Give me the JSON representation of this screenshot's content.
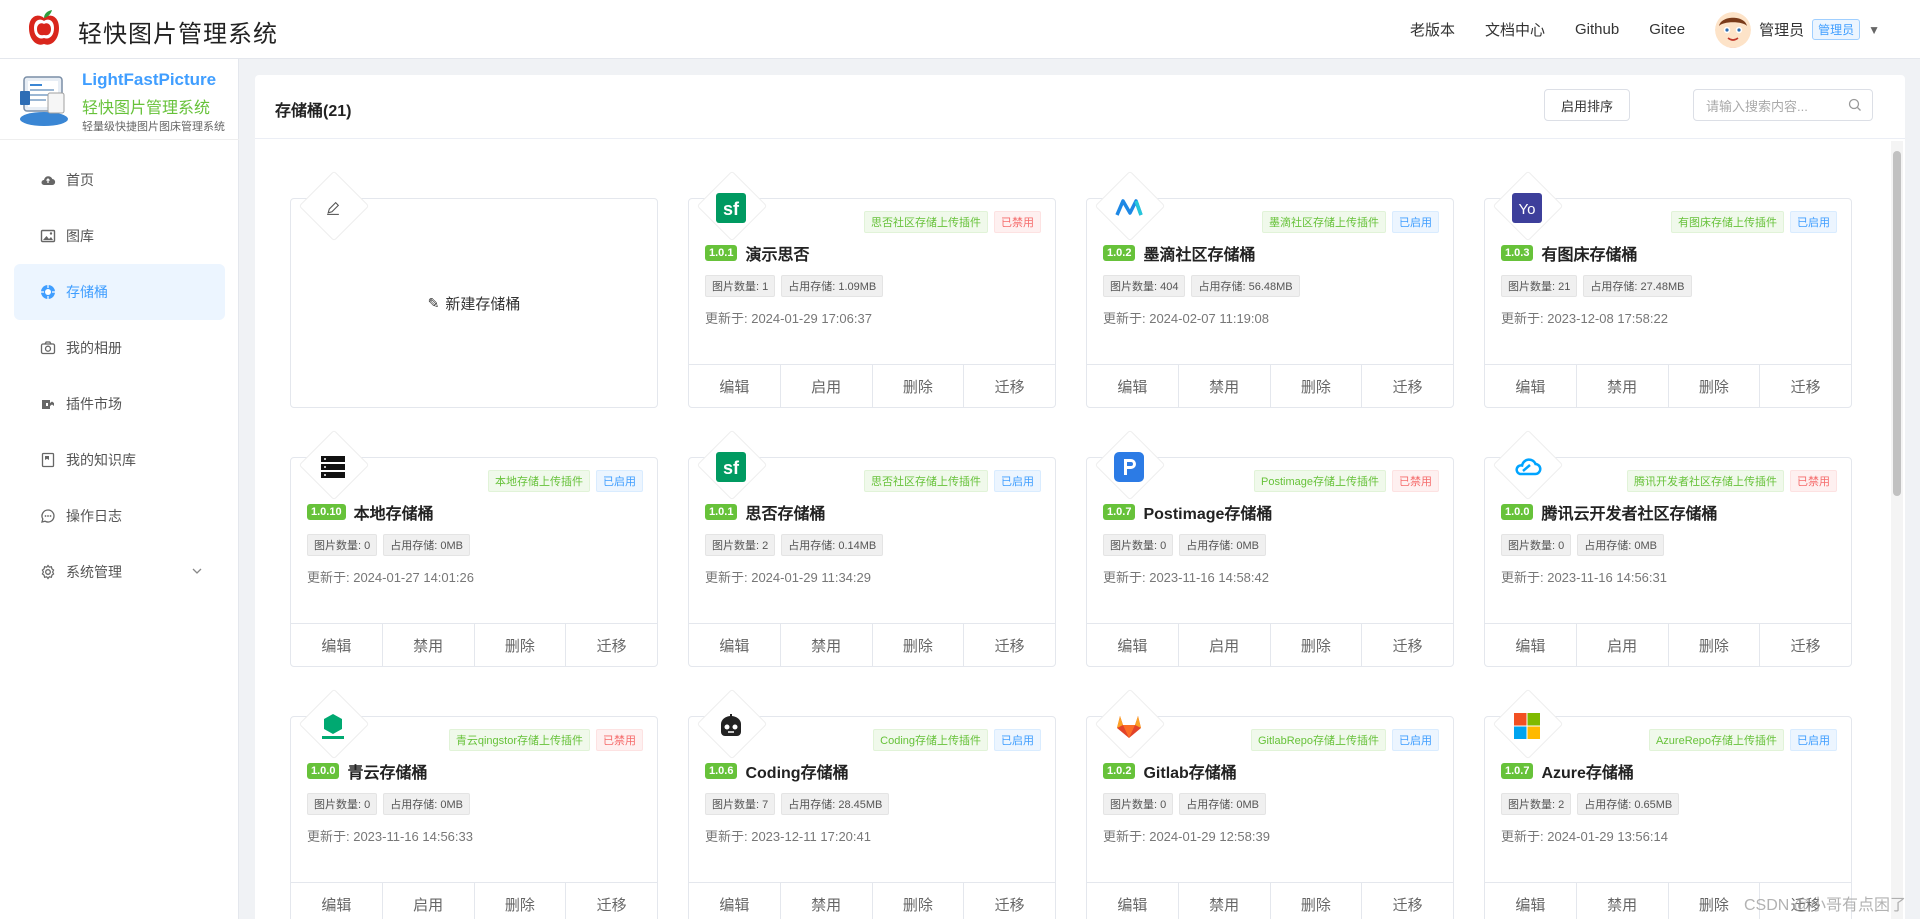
{
  "header": {
    "app_title": "轻快图片管理系统",
    "nav": [
      "老版本",
      "文档中心",
      "Github",
      "Gitee"
    ],
    "user_name": "管理员",
    "role": "管理员"
  },
  "sidebar": {
    "brand_en": "LightFastPicture",
    "brand_cn": "轻快图片管理系统",
    "brand_sub": "轻量级快捷图片图床管理系统",
    "items": [
      {
        "label": "首页",
        "icon": "cloud-icon"
      },
      {
        "label": "图库",
        "icon": "image-icon"
      },
      {
        "label": "存储桶",
        "icon": "storage-icon",
        "active": true
      },
      {
        "label": "我的相册",
        "icon": "camera-icon"
      },
      {
        "label": "插件市场",
        "icon": "plugin-icon"
      },
      {
        "label": "我的知识库",
        "icon": "book-icon"
      },
      {
        "label": "操作日志",
        "icon": "chat-icon"
      },
      {
        "label": "系统管理",
        "icon": "gear-icon"
      }
    ]
  },
  "panel": {
    "title": "存储桶(21)",
    "sort_label": "启用排序",
    "search_placeholder": "请输入搜索内容..."
  },
  "new_bucket_label": "新建存储桶",
  "actions": {
    "edit": "编辑",
    "enable": "启用",
    "disable": "禁用",
    "delete": "删除",
    "migrate": "迁移"
  },
  "cards": [
    {
      "version": "1.0.1",
      "name": "演示思否",
      "plugin": "思否社区存储上传插件",
      "status": "已禁用",
      "count": "图片数量: 1",
      "size": "占用存储: 1.09MB",
      "updated": "更新于: 2024-01-29 17:06:37",
      "toggle": "启用",
      "icon": "sf"
    },
    {
      "version": "1.0.2",
      "name": "墨滴社区存储桶",
      "plugin": "墨滴社区存储上传插件",
      "status": "已启用",
      "count": "图片数量: 404",
      "size": "占用存储: 56.48MB",
      "updated": "更新于: 2024-02-07 11:19:08",
      "toggle": "禁用",
      "icon": "mdnice"
    },
    {
      "version": "1.0.3",
      "name": "有图床存储桶",
      "plugin": "有图床存储上传插件",
      "status": "已启用",
      "count": "图片数量: 21",
      "size": "占用存储: 27.48MB",
      "updated": "更新于: 2023-12-08 17:58:22",
      "toggle": "禁用",
      "icon": "yo"
    },
    {
      "version": "1.0.10",
      "name": "本地存储桶",
      "plugin": "本地存储上传插件",
      "status": "已启用",
      "count": "图片数量: 0",
      "size": "占用存储: 0MB",
      "updated": "更新于: 2024-01-27 14:01:26",
      "toggle": "禁用",
      "icon": "server"
    },
    {
      "version": "1.0.1",
      "name": "思否存储桶",
      "plugin": "思否社区存储上传插件",
      "status": "已启用",
      "count": "图片数量: 2",
      "size": "占用存储: 0.14MB",
      "updated": "更新于: 2024-01-29 11:34:29",
      "toggle": "禁用",
      "icon": "sf"
    },
    {
      "version": "1.0.7",
      "name": "Postimage存储桶",
      "plugin": "Postimage存储上传插件",
      "status": "已禁用",
      "count": "图片数量: 0",
      "size": "占用存储: 0MB",
      "updated": "更新于: 2023-11-16 14:58:42",
      "toggle": "启用",
      "icon": "postimage"
    },
    {
      "version": "1.0.0",
      "name": "腾讯云开发者社区存储桶",
      "plugin": "腾讯开发者社区存储上传插件",
      "status": "已禁用",
      "count": "图片数量: 0",
      "size": "占用存储: 0MB",
      "updated": "更新于: 2023-11-16 14:56:31",
      "toggle": "启用",
      "icon": "tcloud"
    },
    {
      "version": "1.0.0",
      "name": "青云存储桶",
      "plugin": "青云qingstor存储上传插件",
      "status": "已禁用",
      "count": "图片数量: 0",
      "size": "占用存储: 0MB",
      "updated": "更新于: 2023-11-16 14:56:33",
      "toggle": "启用",
      "icon": "qingcloud"
    },
    {
      "version": "1.0.6",
      "name": "Coding存储桶",
      "plugin": "Coding存储上传插件",
      "status": "已启用",
      "count": "图片数量: 7",
      "size": "占用存储: 28.45MB",
      "updated": "更新于: 2023-12-11 17:20:41",
      "toggle": "禁用",
      "icon": "coding"
    },
    {
      "version": "1.0.2",
      "name": "Gitlab存储桶",
      "plugin": "GitlabRepo存储上传插件",
      "status": "已启用",
      "count": "图片数量: 0",
      "size": "占用存储: 0MB",
      "updated": "更新于: 2024-01-29 12:58:39",
      "toggle": "禁用",
      "icon": "gitlab"
    },
    {
      "version": "1.0.7",
      "name": "Azure存储桶",
      "plugin": "AzureRepo存储上传插件",
      "status": "已启用",
      "count": "图片数量: 2",
      "size": "占用存储: 0.65MB",
      "updated": "更新于: 2024-01-29 13:56:14",
      "toggle": "禁用",
      "icon": "azure"
    }
  ],
  "watermark": "CSDN @小哥有点困了"
}
